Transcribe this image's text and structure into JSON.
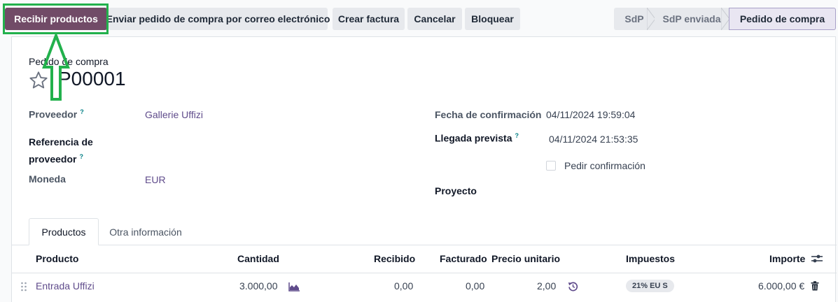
{
  "toolbar": {
    "receive_label": "Recibir productos",
    "email_label": "Enviar pedido de compra por correo electrónico",
    "invoice_label": "Crear factura",
    "cancel_label": "Cancelar",
    "lock_label": "Bloquear"
  },
  "statusbar": {
    "stages": [
      "SdP",
      "SdP enviada",
      "Pedido de compra"
    ],
    "active": "Pedido de compra"
  },
  "document": {
    "type_label": "Pedido de compra",
    "reference": "P00001"
  },
  "fields": {
    "vendor_label": "Proveedor",
    "vendor_value": "Gallerie Uffizi",
    "vendor_ref_label_line1": "Referencia de",
    "vendor_ref_label_line2": "proveedor",
    "currency_label": "Moneda",
    "currency_value": "EUR",
    "confirmation_date_label": "Fecha de confirmación",
    "confirmation_date_value": "04/11/2024 19:59:04",
    "expected_arrival_label": "Llegada prevista",
    "expected_arrival_value": "04/11/2024 21:53:35",
    "ask_confirmation_label": "Pedir confirmación",
    "project_label": "Proyecto",
    "help_mark": "?"
  },
  "tabs": [
    "Productos",
    "Otra información"
  ],
  "table": {
    "headers": {
      "product": "Producto",
      "quantity": "Cantidad",
      "received": "Recibido",
      "billed": "Facturado",
      "unit_price": "Precio unitario",
      "taxes": "Impuestos",
      "amount": "Importe"
    },
    "rows": [
      {
        "product": "Entrada Uffizi",
        "quantity": "3.000,00",
        "received": "0,00",
        "billed": "0,00",
        "unit_price": "2,00",
        "tax_badge": "21% EU S",
        "amount": "6.000,00 €"
      }
    ]
  },
  "colors": {
    "primary": "#714b67",
    "highlight": "#22b14c",
    "link": "#5f4b8b"
  }
}
